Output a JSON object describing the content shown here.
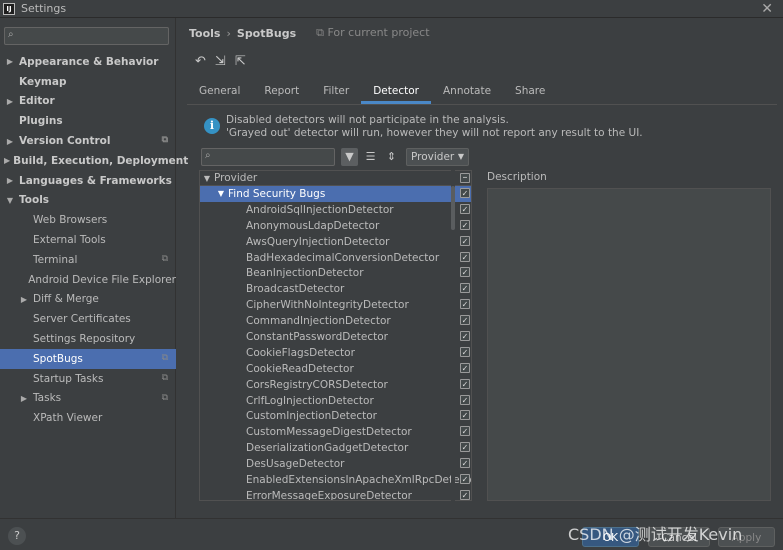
{
  "window": {
    "title": "Settings",
    "app_icon_text": "IJ"
  },
  "sidebar": {
    "search_placeholder": "",
    "items": [
      {
        "label": "Appearance & Behavior",
        "arrow": "▶",
        "bold": true,
        "indent": 0,
        "project": false,
        "selected": false
      },
      {
        "label": "Keymap",
        "arrow": "",
        "bold": true,
        "indent": 0,
        "project": false,
        "selected": false
      },
      {
        "label": "Editor",
        "arrow": "▶",
        "bold": true,
        "indent": 0,
        "project": false,
        "selected": false
      },
      {
        "label": "Plugins",
        "arrow": "",
        "bold": true,
        "indent": 0,
        "project": false,
        "selected": false
      },
      {
        "label": "Version Control",
        "arrow": "▶",
        "bold": true,
        "indent": 0,
        "project": true,
        "selected": false
      },
      {
        "label": "Build, Execution, Deployment",
        "arrow": "▶",
        "bold": true,
        "indent": 0,
        "project": false,
        "selected": false
      },
      {
        "label": "Languages & Frameworks",
        "arrow": "▶",
        "bold": true,
        "indent": 0,
        "project": false,
        "selected": false
      },
      {
        "label": "Tools",
        "arrow": "▼",
        "bold": true,
        "indent": 0,
        "project": false,
        "selected": false
      },
      {
        "label": "Web Browsers",
        "arrow": "",
        "bold": false,
        "indent": 1,
        "project": false,
        "selected": false
      },
      {
        "label": "External Tools",
        "arrow": "",
        "bold": false,
        "indent": 1,
        "project": false,
        "selected": false
      },
      {
        "label": "Terminal",
        "arrow": "",
        "bold": false,
        "indent": 1,
        "project": true,
        "selected": false
      },
      {
        "label": "Android Device File Explorer",
        "arrow": "",
        "bold": false,
        "indent": 1,
        "project": false,
        "selected": false
      },
      {
        "label": "Diff & Merge",
        "arrow": "▶",
        "bold": false,
        "indent": 1,
        "project": false,
        "selected": false
      },
      {
        "label": "Server Certificates",
        "arrow": "",
        "bold": false,
        "indent": 1,
        "project": false,
        "selected": false
      },
      {
        "label": "Settings Repository",
        "arrow": "",
        "bold": false,
        "indent": 1,
        "project": false,
        "selected": false
      },
      {
        "label": "SpotBugs",
        "arrow": "",
        "bold": false,
        "indent": 1,
        "project": true,
        "selected": true
      },
      {
        "label": "Startup Tasks",
        "arrow": "",
        "bold": false,
        "indent": 1,
        "project": true,
        "selected": false
      },
      {
        "label": "Tasks",
        "arrow": "▶",
        "bold": false,
        "indent": 1,
        "project": true,
        "selected": false
      },
      {
        "label": "XPath Viewer",
        "arrow": "",
        "bold": false,
        "indent": 1,
        "project": false,
        "selected": false
      }
    ]
  },
  "breadcrumb": {
    "parent": "Tools",
    "separator": "›",
    "current": "SpotBugs",
    "project_note": "For current project"
  },
  "toolbar_icons": [
    "undo-icon",
    "import-icon",
    "export-icon"
  ],
  "tabs": [
    {
      "label": "General",
      "active": false
    },
    {
      "label": "Report",
      "active": false
    },
    {
      "label": "Filter",
      "active": false
    },
    {
      "label": "Detector",
      "active": true
    },
    {
      "label": "Annotate",
      "active": false
    },
    {
      "label": "Share",
      "active": false
    }
  ],
  "info": {
    "line1": "Disabled detectors will not participate in the analysis.",
    "line2": "'Grayed out' detector will run, however they will not report any result to the UI."
  },
  "filter": {
    "search_placeholder": "",
    "group_by": "Provider"
  },
  "detector_list": {
    "header": "Provider",
    "group": "Find Security Bugs",
    "detectors": [
      "AndroidSqlInjectionDetector",
      "AnonymousLdapDetector",
      "AwsQueryInjectionDetector",
      "BadHexadecimalConversionDetector",
      "BeanInjectionDetector",
      "BroadcastDetector",
      "CipherWithNoIntegrityDetector",
      "CommandInjectionDetector",
      "ConstantPasswordDetector",
      "CookieFlagsDetector",
      "CookieReadDetector",
      "CorsRegistryCORSDetector",
      "CrlfLogInjectionDetector",
      "CustomInjectionDetector",
      "CustomMessageDigestDetector",
      "DeserializationGadgetDetector",
      "DesUsageDetector",
      "EnabledExtensionsInApacheXmlRpcDetector",
      "ErrorMessageExposureDetector"
    ]
  },
  "description": {
    "label": "Description"
  },
  "footer": {
    "ok": "OK",
    "cancel": "Cancel",
    "apply": "Apply",
    "help": "?"
  },
  "watermark": "CSDN @测试开发Kevin",
  "colors": {
    "selection": "#4b6eaf",
    "background": "#3c3f41",
    "accent_tab": "#4a88c7",
    "info_icon": "#3592c4"
  }
}
